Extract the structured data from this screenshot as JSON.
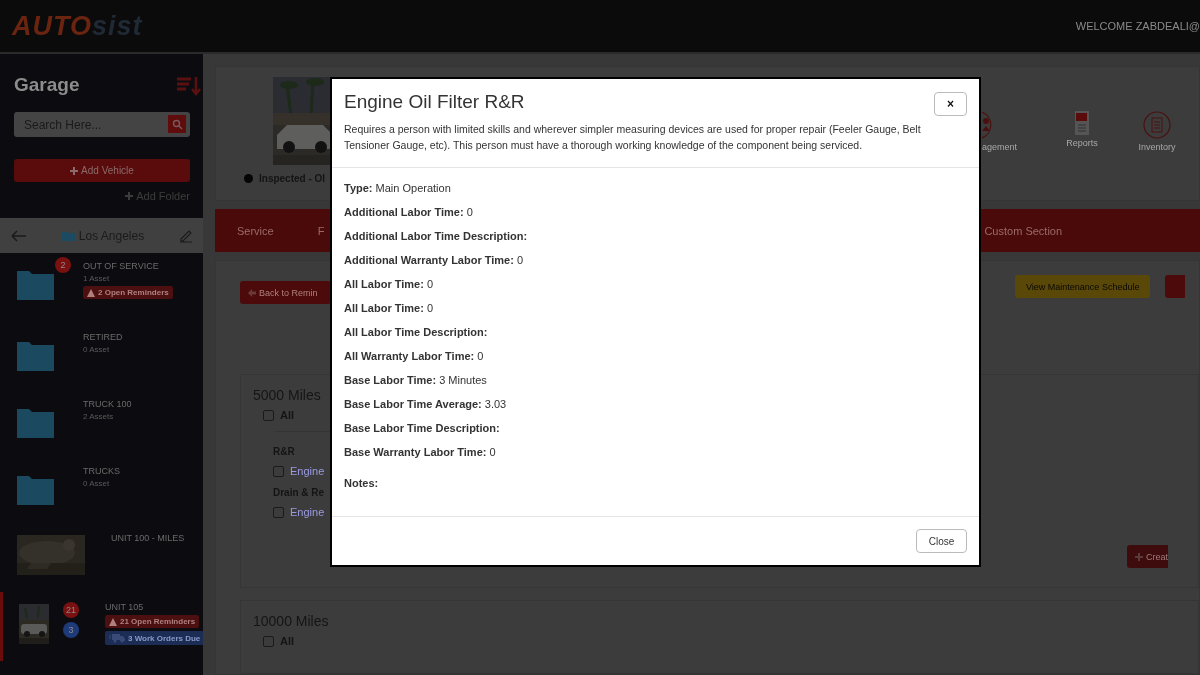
{
  "header": {
    "logo_primary": "AUTO",
    "logo_secondary": "sist",
    "welcome": "WELCOME ZABDEALI@"
  },
  "sidebar": {
    "title": "Garage",
    "search": {
      "placeholder": "Search Here..."
    },
    "add_vehicle": "Add Vehicle",
    "add_folder": "Add Folder",
    "folder": "Los Angeles",
    "items": [
      {
        "kind": "folder",
        "name": "OUT OF SERVICE",
        "sub": "1 Asset",
        "selected": false,
        "badges": [
          {
            "text": "2",
            "color": "#7a1010"
          }
        ],
        "tags": [
          {
            "kind": "reminders",
            "text": "2 Open Reminders"
          }
        ]
      },
      {
        "kind": "folder",
        "name": "RETIRED",
        "sub": "0 Asset",
        "selected": false
      },
      {
        "kind": "folder",
        "name": "TRUCK 100",
        "sub": "2 Assets",
        "selected": false
      },
      {
        "kind": "folder",
        "name": "TRUCKS",
        "sub": "0 Asset",
        "selected": false
      },
      {
        "kind": "vehicle",
        "name": "UNIT 100 - MILES",
        "selected": false
      },
      {
        "kind": "vehicle",
        "name": "UNIT 105",
        "selected": true,
        "badges": [
          {
            "text": "21",
            "color": "#7a1010"
          },
          {
            "text": "3",
            "color": "#1e3a78"
          }
        ],
        "tags": [
          {
            "kind": "reminders",
            "text": "21 Open Reminders"
          },
          {
            "kind": "work_orders",
            "text": "3 Work Orders Due"
          }
        ]
      }
    ]
  },
  "vehicle": {
    "status": "Inspected - Ol",
    "tools": [
      {
        "label": "agement",
        "kind": "people"
      },
      {
        "label": "Reports",
        "kind": "reports"
      },
      {
        "label": "Inventory",
        "kind": "inventory"
      }
    ]
  },
  "tabs": [
    {
      "label": "Service"
    },
    {
      "label": "F"
    },
    {
      "label": "Custom Section"
    }
  ],
  "actions": {
    "back": "Back to Remin",
    "schedule": "View Maintenance Schedule",
    "create": "Creat"
  },
  "sections": [
    {
      "title": "5000 Miles",
      "all": {
        "label": "All",
        "checked": false
      },
      "groups": [
        {
          "title": "R&R",
          "items": [
            {
              "label": "Engine",
              "checked": false
            }
          ]
        },
        {
          "title": "Drain & Re",
          "items": [
            {
              "label": "Engine",
              "checked": false
            }
          ]
        }
      ]
    },
    {
      "title": "10000 Miles",
      "all": {
        "label": "All",
        "checked": false
      }
    }
  ],
  "modal": {
    "title": "Engine Oil Filter R&R",
    "description": "Requires a person with limited skills and wherever simpler measuring devices are used for proper repair (Feeler Gauge, Belt Tensioner Gauge, etc). This person must have a thorough working knowledge of the component being serviced.",
    "close_icon": "×",
    "fields": [
      {
        "label": "Type:",
        "value": "Main Operation"
      },
      {
        "label": "Additional Labor Time:",
        "value": "0"
      },
      {
        "label": "Additional Labor Time Description:"
      },
      {
        "label": "Additional Warranty Labor Time:",
        "value": "0"
      },
      {
        "label": "All Labor Time:",
        "value": "0"
      },
      {
        "label": "All Labor Time:",
        "value": "0"
      },
      {
        "label": "All Labor Time Description:"
      },
      {
        "label": "All Warranty Labor Time:",
        "value": "0"
      },
      {
        "label": "Base Labor Time:",
        "value": "3 Minutes"
      },
      {
        "label": "Base Labor Time Average:",
        "value": "3.03"
      },
      {
        "label": "Base Labor Time Description:"
      },
      {
        "label": "Base Warranty Labor Time:",
        "value": "0"
      }
    ],
    "notes": "Notes:",
    "close": "Close"
  }
}
